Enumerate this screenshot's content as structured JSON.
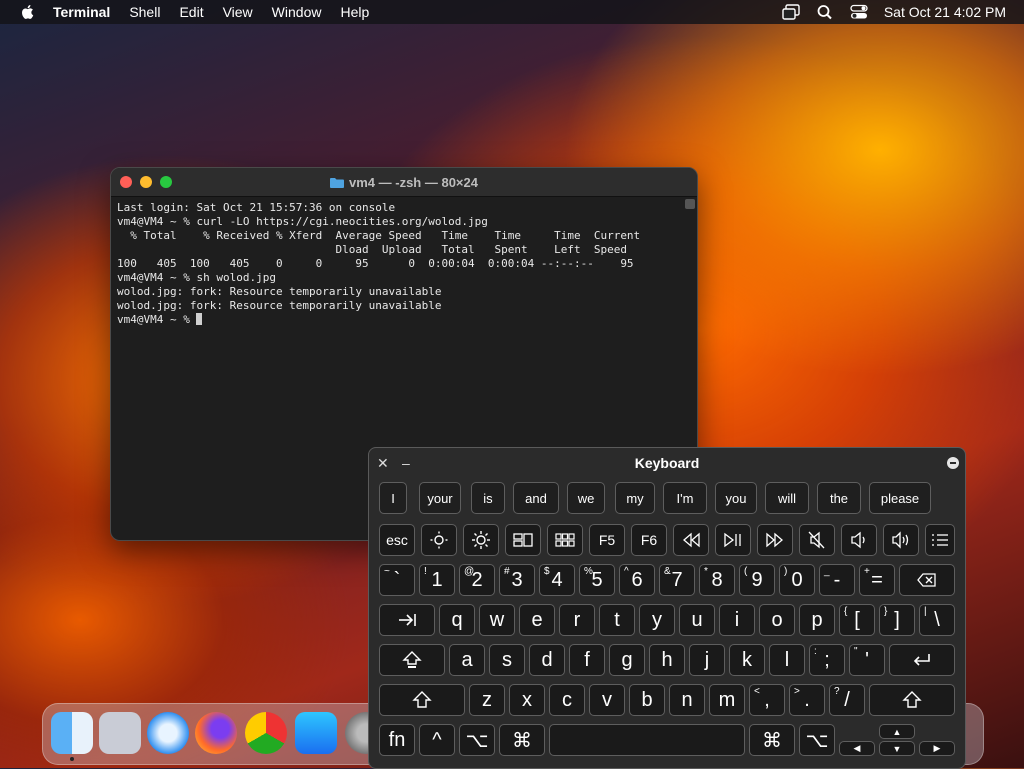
{
  "menubar": {
    "app_name": "Terminal",
    "items": [
      "Shell",
      "Edit",
      "View",
      "Window",
      "Help"
    ],
    "clock": "Sat Oct 21  4:02 PM",
    "status_icons": [
      "screen-mirroring-icon",
      "search-icon",
      "control-center-icon"
    ]
  },
  "terminal": {
    "title": "vm4 — -zsh — 80×24",
    "lines": [
      "Last login: Sat Oct 21 15:57:36 on console",
      "vm4@VM4 ~ % curl -LO https://cgi.neocities.org/wolod.jpg",
      "  % Total    % Received % Xferd  Average Speed   Time    Time     Time  Current",
      "                                 Dload  Upload   Total   Spent    Left  Speed",
      "100   405  100   405    0     0     95      0  0:00:04  0:00:04 --:--:--    95",
      "vm4@VM4 ~ % sh wolod.jpg",
      "wolod.jpg: fork: Resource temporarily unavailable",
      "wolod.jpg: fork: Resource temporarily unavailable"
    ],
    "prompt": "vm4@VM4 ~ % "
  },
  "keyboard": {
    "title": "Keyboard",
    "suggestions": [
      "I",
      "your",
      "is",
      "and",
      "we",
      "my",
      "I'm",
      "you",
      "will",
      "the",
      "please"
    ],
    "esc": "esc",
    "f5": "F5",
    "f6": "F6",
    "num_row": [
      {
        "s": "~",
        "m": "`"
      },
      {
        "s": "!",
        "m": "1"
      },
      {
        "s": "@",
        "m": "2"
      },
      {
        "s": "#",
        "m": "3"
      },
      {
        "s": "$",
        "m": "4"
      },
      {
        "s": "%",
        "m": "5"
      },
      {
        "s": "^",
        "m": "6"
      },
      {
        "s": "&",
        "m": "7"
      },
      {
        "s": "*",
        "m": "8"
      },
      {
        "s": "(",
        "m": "9"
      },
      {
        "s": ")",
        "m": "0"
      },
      {
        "s": "_",
        "m": "-"
      },
      {
        "s": "+",
        "m": "="
      }
    ],
    "row_q": [
      "q",
      "w",
      "e",
      "r",
      "t",
      "y",
      "u",
      "i",
      "o",
      "p"
    ],
    "row_q_extra": [
      {
        "s": "{",
        "m": "["
      },
      {
        "s": "}",
        "m": "]"
      },
      {
        "s": "|",
        "m": "\\"
      }
    ],
    "row_a": [
      "a",
      "s",
      "d",
      "f",
      "g",
      "h",
      "j",
      "k",
      "l"
    ],
    "row_a_extra": [
      {
        "s": ":",
        "m": ";"
      },
      {
        "s": "\"",
        "m": "'"
      }
    ],
    "row_z": [
      "z",
      "x",
      "c",
      "v",
      "b",
      "n",
      "m"
    ],
    "row_z_extra": [
      {
        "s": "<",
        "m": ","
      },
      {
        "s": ">",
        "m": "."
      },
      {
        "s": "?",
        "m": "/"
      }
    ],
    "fn": "fn"
  }
}
